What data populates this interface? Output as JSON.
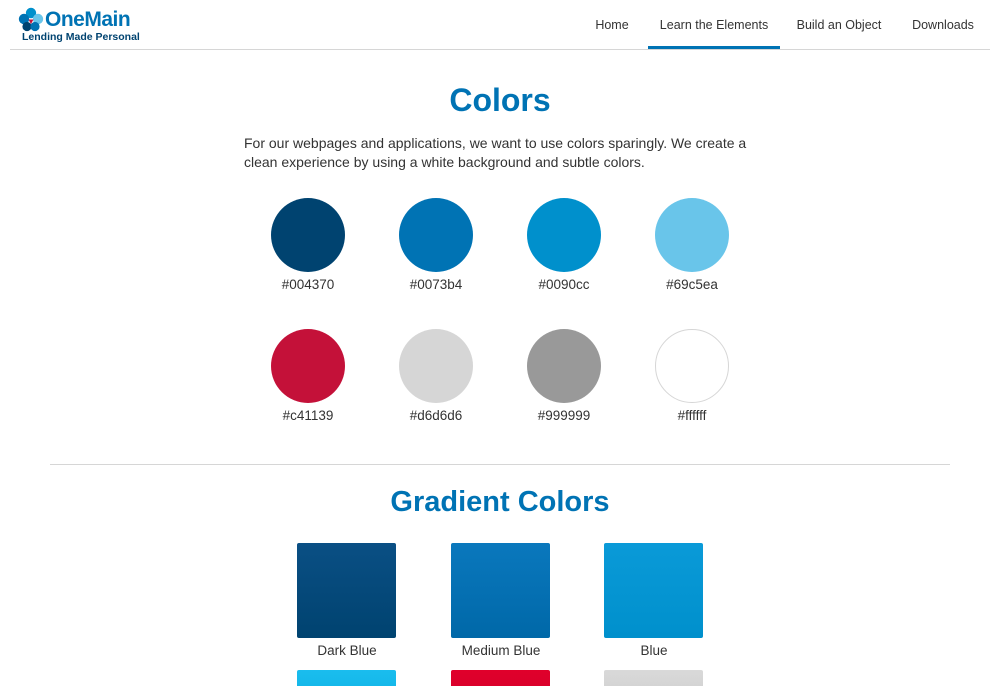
{
  "brand": {
    "name": "OneMain",
    "tagline": "Lending Made Personal",
    "primary": "#0073b4",
    "dark": "#004370",
    "accent_red": "#c41139"
  },
  "nav": {
    "items": [
      {
        "label": "Home",
        "active": false
      },
      {
        "label": "Learn the Elements",
        "active": true
      },
      {
        "label": "Build an Object",
        "active": false
      },
      {
        "label": "Downloads",
        "active": false
      }
    ]
  },
  "colors_section": {
    "title": "Colors",
    "intro": "For our webpages and applications, we want to use colors sparingly. We create a clean experience by using a white background and subtle colors.",
    "swatches": [
      {
        "hex": "#004370",
        "label": "#004370"
      },
      {
        "hex": "#0073b4",
        "label": "#0073b4"
      },
      {
        "hex": "#0090cc",
        "label": "#0090cc"
      },
      {
        "hex": "#69c5ea",
        "label": "#69c5ea"
      },
      {
        "hex": "#c41139",
        "label": "#c41139"
      },
      {
        "hex": "#d6d6d6",
        "label": "#d6d6d6"
      },
      {
        "hex": "#999999",
        "label": "#999999"
      },
      {
        "hex": "#ffffff",
        "label": "#ffffff"
      }
    ]
  },
  "gradient_section": {
    "title": "Gradient Colors",
    "items": [
      {
        "label": "Dark Blue",
        "from": "#0a4f84",
        "to": "#004370"
      },
      {
        "label": "Medium Blue",
        "from": "#0a78bd",
        "to": "#0068a8"
      },
      {
        "label": "Blue",
        "from": "#0a9ad8",
        "to": "#0090cc"
      },
      {
        "label": "",
        "from": "#1abdee",
        "to": "#10b4e6"
      },
      {
        "label": "",
        "from": "#e0002b",
        "to": "#d6002a"
      },
      {
        "label": "",
        "from": "#d9d9d9",
        "to": "#d0d0d0"
      }
    ]
  }
}
